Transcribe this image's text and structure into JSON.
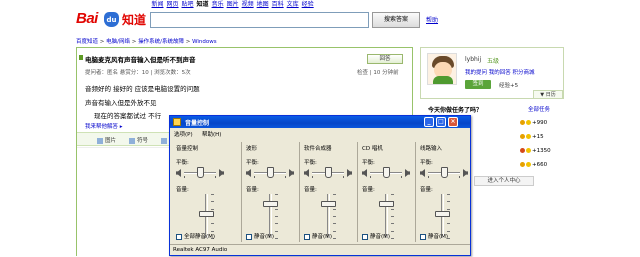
{
  "header": {
    "logo": {
      "bai": "Bai",
      "du": "du",
      "zhidao": "知道"
    },
    "nav": [
      "新闻",
      "网页",
      "贴吧",
      "知道",
      "音乐",
      "图片",
      "视频",
      "地图",
      "百科",
      "文库",
      "经验"
    ],
    "nav_current": "知道",
    "search_value": "",
    "search_button": "搜索答案",
    "help_link": "帮助"
  },
  "breadcrumb": {
    "items": [
      "百度知道",
      "电脑/网络",
      "操作系统/系统故障",
      "Windows"
    ],
    "separator": " > "
  },
  "question": {
    "title": "电脑麦克风有声音输入但是听不到声音",
    "reply_button": "回答",
    "meta_left": "提问者：匿名    悬赏分：10  |  浏览次数：5次",
    "meta_right": "检查  |  10 分钟前",
    "line1": "音频好的 接好的  应该是电脑设置的问题",
    "line2": "声音有输入但是外放不见",
    "line3": "现在的答案都试过 不行",
    "more_link": "我来帮他解答 ▸",
    "toolbar": [
      "图片",
      "符号",
      "公式"
    ]
  },
  "user_panel": {
    "name": "lybhij",
    "level": "五级",
    "links": "我的提问  我的回答  积分商城",
    "sign_button": "签到",
    "sign_note": "经验+5",
    "collapse": "▼ 日历"
  },
  "ranking": {
    "title": "今天你做任务了吗？",
    "all_link": "全部任务",
    "rows": [
      {
        "value": "+990",
        "color": "#e6a100"
      },
      {
        "value": "+15",
        "color": "#e6a100"
      },
      {
        "value": "+1350",
        "color": "#d44a1a"
      },
      {
        "value": "+660",
        "color": "#e6a100"
      }
    ],
    "enter_button": "进入个人中心"
  },
  "volume_window": {
    "title": "音量控制",
    "menu": [
      "选项(P)",
      "帮助(H)"
    ],
    "balance_label": "平衡:",
    "volume_label": "音量:",
    "channels": [
      {
        "name": "音量控制",
        "mute_label": "全部静音(M)",
        "balance": 0.5,
        "volume": 0.55,
        "muted": false
      },
      {
        "name": "波形",
        "mute_label": "静音(M)",
        "balance": 0.5,
        "volume": 0.82,
        "muted": false
      },
      {
        "name": "软件合成器",
        "mute_label": "静音(M)",
        "balance": 0.5,
        "volume": 0.82,
        "muted": false
      },
      {
        "name": "CD 唱机",
        "mute_label": "静音(M)",
        "balance": 0.5,
        "volume": 0.82,
        "muted": false
      },
      {
        "name": "线路输入",
        "mute_label": "静音(M)",
        "balance": 0.5,
        "volume": 0.55,
        "muted": false
      }
    ],
    "status": "Realtek AC97 Audio"
  },
  "colors": {
    "accent_green": "#5aa43a",
    "link_blue": "#0000cc",
    "xp_title_blue": "#0a5ce6",
    "close_red": "#d8573a"
  }
}
